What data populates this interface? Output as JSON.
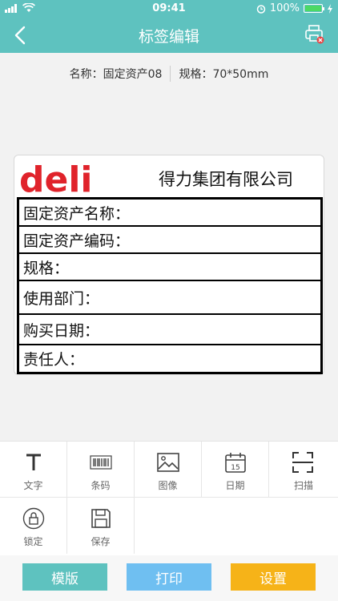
{
  "status": {
    "time": "09:41",
    "battery": "100%"
  },
  "nav": {
    "title": "标签编辑"
  },
  "info": {
    "name": "名称：固定资产08",
    "size": "规格：70*50mm"
  },
  "label": {
    "logo_text": "deli",
    "company": "得力集团有限公司",
    "rows": [
      "固定资产名称：",
      "固定资产编码：",
      "规格：",
      "使用部门：",
      "购买日期：",
      "责任人："
    ]
  },
  "tools": [
    {
      "label": "文字",
      "icon": "text-icon"
    },
    {
      "label": "条码",
      "icon": "barcode-icon"
    },
    {
      "label": "图像",
      "icon": "image-icon"
    },
    {
      "label": "日期",
      "icon": "calendar-icon",
      "day": "15"
    },
    {
      "label": "扫描",
      "icon": "scan-icon"
    },
    {
      "label": "锁定",
      "icon": "lock-icon"
    },
    {
      "label": "保存",
      "icon": "save-icon"
    }
  ],
  "buttons": {
    "template": "模版",
    "print": "打印",
    "settings": "设置"
  },
  "colors": {
    "theme": "#5ec2bf",
    "template_btn": "#5ec2bf",
    "print_btn": "#6fbff1",
    "settings_btn": "#f6b318",
    "logo_red": "#e0232b"
  }
}
